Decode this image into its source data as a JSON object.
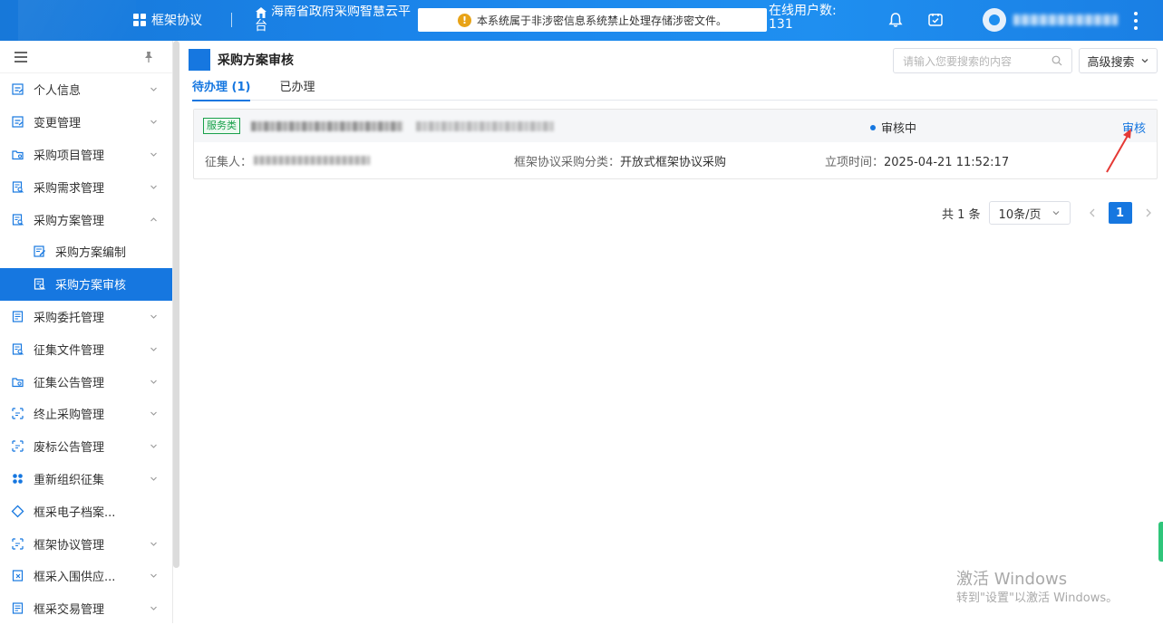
{
  "topbar": {
    "module": "框架协议",
    "platform_line1": "海南省政府采购智慧云平",
    "platform_line2": "台",
    "notice": "本系统属于非涉密信息系统禁止处理存储涉密文件。",
    "online_label": "在线用户数:",
    "online_count": "131",
    "icons": [
      "grid-icon",
      "home-icon",
      "warning-icon",
      "bell-icon",
      "message-check-icon",
      "avatar",
      "more-vertical-icon"
    ]
  },
  "sidebar": {
    "items": [
      {
        "label": "个人信息",
        "icon": "form-icon",
        "expandable": true
      },
      {
        "label": "变更管理",
        "icon": "form-icon",
        "expandable": true
      },
      {
        "label": "采购项目管理",
        "icon": "folder-icon",
        "expandable": true
      },
      {
        "label": "采购需求管理",
        "icon": "doc-search-icon",
        "expandable": true
      },
      {
        "label": "采购方案管理",
        "icon": "doc-search-icon",
        "expandable": true,
        "expanded": true
      },
      {
        "label": "采购方案编制",
        "icon": "edit-doc-icon",
        "sub": true
      },
      {
        "label": "采购方案审核",
        "icon": "doc-search-icon",
        "sub": true,
        "active": true
      },
      {
        "label": "采购委托管理",
        "icon": "doc-list-icon",
        "expandable": true
      },
      {
        "label": "征集文件管理",
        "icon": "doc-search-icon",
        "expandable": true
      },
      {
        "label": "征集公告管理",
        "icon": "folder-search-icon",
        "expandable": true
      },
      {
        "label": "终止采购管理",
        "icon": "frame-icon",
        "expandable": true
      },
      {
        "label": "废标公告管理",
        "icon": "frame-icon",
        "expandable": true
      },
      {
        "label": "重新组织征集",
        "icon": "apps-icon",
        "expandable": true
      },
      {
        "label": "框采电子档案...",
        "icon": "diamond-icon",
        "expandable": false
      },
      {
        "label": "框架协议管理",
        "icon": "frame-icon",
        "expandable": true
      },
      {
        "label": "框采入围供应...",
        "icon": "doc-x-icon",
        "expandable": true
      },
      {
        "label": "框采交易管理",
        "icon": "doc-list-icon",
        "expandable": true
      }
    ]
  },
  "main": {
    "title": "采购方案审核",
    "search_placeholder": "请输入您要搜索的内容",
    "advanced_search": "高级搜索",
    "tabs": [
      {
        "label": "待办理 (1)",
        "active": true
      },
      {
        "label": "已办理",
        "active": false
      }
    ],
    "record": {
      "tag": "服务类",
      "status": "审核中",
      "action": "审核",
      "collector_label": "征集人：",
      "category_label": "框架协议采购分类：",
      "category_value": "开放式框架协议采购",
      "time_label": "立项时间：",
      "time_value": "2025-04-21 11:52:17"
    },
    "pagination": {
      "total": "共 1 条",
      "page_size": "10条/页",
      "current_page": "1"
    }
  },
  "watermark": {
    "line1": "激活 Windows",
    "line2": "转到\"设置\"以激活 Windows。"
  },
  "colors": {
    "primary": "#1677e0",
    "tag_green": "#19a04b",
    "annotation_red": "#e53935"
  }
}
